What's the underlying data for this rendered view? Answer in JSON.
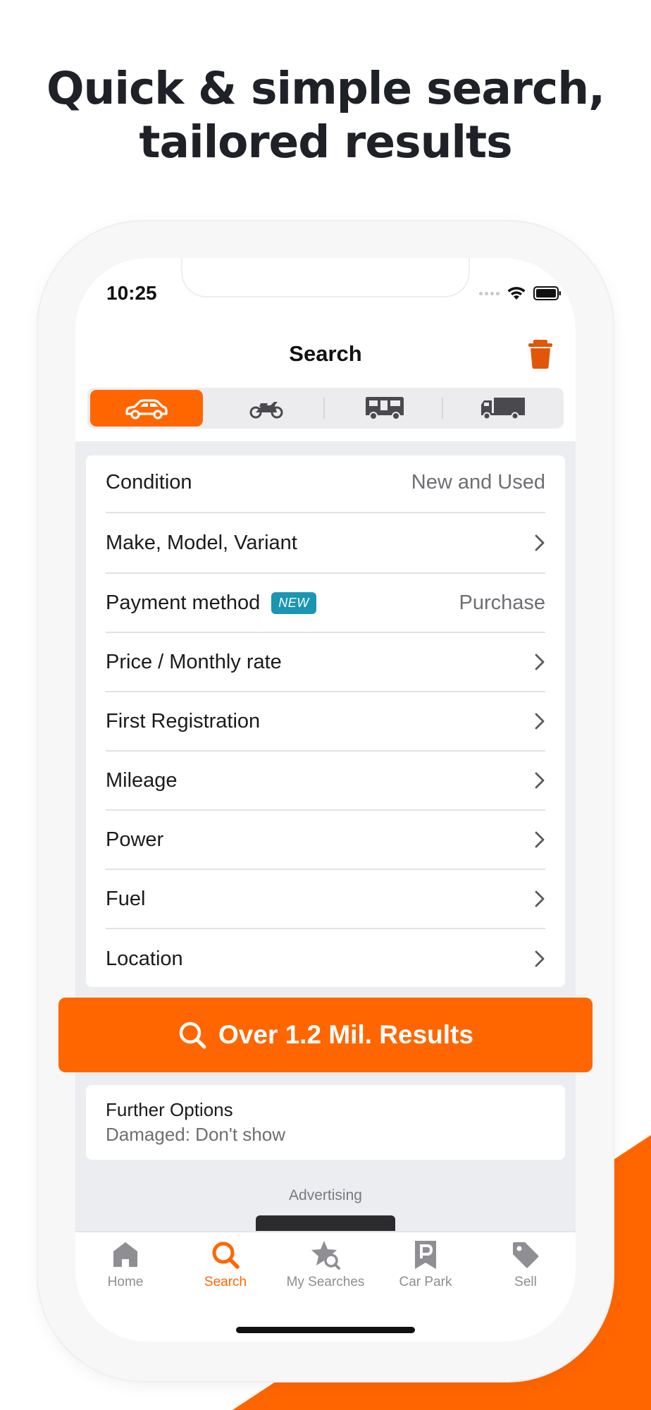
{
  "headline": {
    "line1": "Quick & simple search,",
    "line2": "tailored results"
  },
  "colors": {
    "brand_orange": "#ff6600",
    "badge_teal": "#1a95b2",
    "text_primary": "#1b1b1d",
    "text_secondary": "#6e6e73"
  },
  "status_bar": {
    "time": "10:25",
    "icons": [
      "signal-icon",
      "wifi-icon",
      "battery-icon"
    ]
  },
  "nav": {
    "title": "Search",
    "trash_icon": "trash-icon"
  },
  "vehicle_tabs": [
    {
      "name": "car",
      "icon": "car-icon",
      "selected": true
    },
    {
      "name": "motorbike",
      "icon": "motorbike-icon",
      "selected": false
    },
    {
      "name": "motorhome",
      "icon": "motorhome-icon",
      "selected": false
    },
    {
      "name": "truck",
      "icon": "truck-icon",
      "selected": false
    }
  ],
  "filters": [
    {
      "label": "Condition",
      "value": "New and Used"
    },
    {
      "label": "Make, Model, Variant",
      "value": ""
    },
    {
      "label": "Payment method",
      "badge": "NEW",
      "value": "Purchase"
    },
    {
      "label": "Price / Monthly rate",
      "value": ""
    },
    {
      "label": "First Registration",
      "value": ""
    },
    {
      "label": "Mileage",
      "value": ""
    },
    {
      "label": "Power",
      "value": ""
    },
    {
      "label": "Fuel",
      "value": ""
    },
    {
      "label": "Location",
      "value": ""
    }
  ],
  "results_button": {
    "label": "Over 1.2 Mil. Results",
    "icon": "search-icon"
  },
  "further_options": {
    "title": "Further Options",
    "subtitle": "Damaged: Don't show"
  },
  "advertising_label": "Advertising",
  "tabbar": [
    {
      "label": "Home",
      "icon": "home-icon",
      "active": false
    },
    {
      "label": "Search",
      "icon": "search-icon",
      "active": true
    },
    {
      "label": "My Searches",
      "icon": "star-search-icon",
      "active": false
    },
    {
      "label": "Car Park",
      "icon": "parking-icon",
      "active": false
    },
    {
      "label": "Sell",
      "icon": "tag-icon",
      "active": false
    }
  ]
}
